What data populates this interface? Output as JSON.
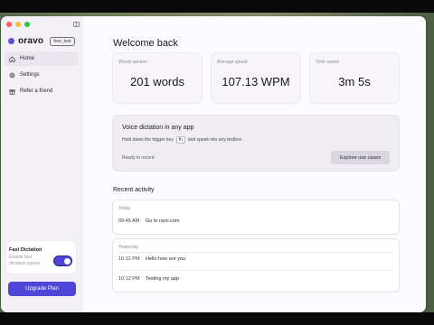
{
  "window": {
    "traffic_colors": [
      "#ff5f57",
      "#febc2e",
      "#28c840"
    ]
  },
  "sidebar": {
    "brand": "oravo",
    "tier_badge": "free_test",
    "items": [
      {
        "label": "Home",
        "icon": "home-icon",
        "active": true
      },
      {
        "label": "Settings",
        "icon": "gear-icon",
        "active": false
      },
      {
        "label": "Refer a friend",
        "icon": "gift-icon",
        "active": false
      }
    ],
    "fast_dictation": {
      "title": "Fast Dictation",
      "subtitle": "Enable fast dictation speed",
      "enabled": true
    },
    "upgrade_label": "Upgrade Plan"
  },
  "main": {
    "welcome": "Welcome back",
    "stats": [
      {
        "label": "Words spoken",
        "value": "201 words"
      },
      {
        "label": "Average speed",
        "value": "107.13 WPM"
      },
      {
        "label": "Time saved",
        "value": "3m 5s"
      }
    ],
    "voice_card": {
      "title": "Voice dictation in any app",
      "desc_before": "Hold down the trigger key",
      "key": "fn",
      "desc_after": "and speak into any textbox",
      "status": "Ready to record",
      "button": "Explore use cases"
    },
    "recent_title": "Recent activity",
    "activity_groups": [
      {
        "label": "Today",
        "entries": [
          {
            "time": "09:45 AM",
            "text": "Go to ravo.com"
          }
        ]
      },
      {
        "label": "Yesterday",
        "entries": [
          {
            "time": "10:12 PM",
            "text": "Hello how are you"
          },
          {
            "time": "10:12 PM",
            "text": "Testing my app"
          }
        ]
      }
    ]
  },
  "colors": {
    "accent": "#4f45d6"
  }
}
